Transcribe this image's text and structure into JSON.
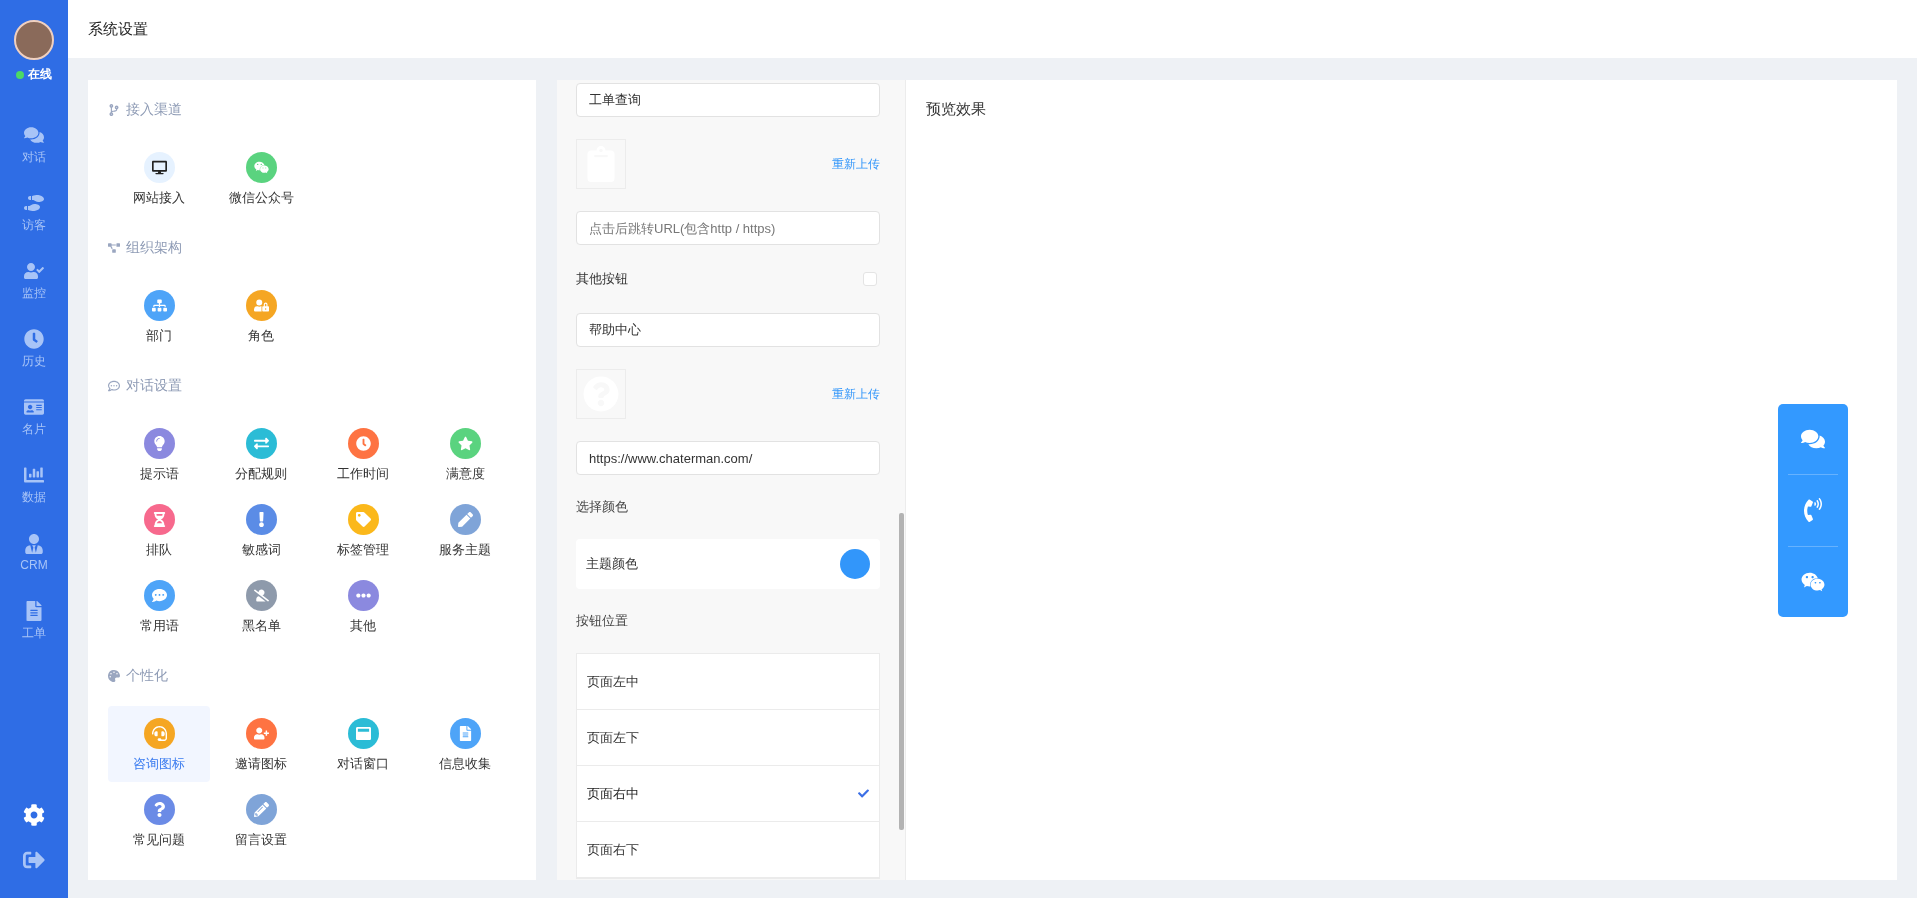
{
  "sidebar": {
    "status": "在线",
    "nav": [
      {
        "label": "对话"
      },
      {
        "label": "访客"
      },
      {
        "label": "监控"
      },
      {
        "label": "历史"
      },
      {
        "label": "名片"
      },
      {
        "label": "数据"
      },
      {
        "label": "CRM"
      },
      {
        "label": "工单"
      }
    ]
  },
  "header": {
    "title": "系统设置"
  },
  "settings_menu": {
    "sections": [
      {
        "title": "接入渠道",
        "items": [
          {
            "label": "网站接入",
            "selected": false
          },
          {
            "label": "微信公众号",
            "selected": false
          }
        ]
      },
      {
        "title": "组织架构",
        "items": [
          {
            "label": "部门",
            "selected": false
          },
          {
            "label": "角色",
            "selected": false
          }
        ]
      },
      {
        "title": "对话设置",
        "items": [
          {
            "label": "提示语",
            "selected": false
          },
          {
            "label": "分配规则",
            "selected": false
          },
          {
            "label": "工作时间",
            "selected": false
          },
          {
            "label": "满意度",
            "selected": false
          },
          {
            "label": "排队",
            "selected": false
          },
          {
            "label": "敏感词",
            "selected": false
          },
          {
            "label": "标签管理",
            "selected": false
          },
          {
            "label": "服务主题",
            "selected": false
          },
          {
            "label": "常用语",
            "selected": false
          },
          {
            "label": "黑名单",
            "selected": false
          },
          {
            "label": "其他",
            "selected": false
          }
        ]
      },
      {
        "title": "个性化",
        "items": [
          {
            "label": "咨询图标",
            "selected": true
          },
          {
            "label": "邀请图标",
            "selected": false
          },
          {
            "label": "对话窗口",
            "selected": false
          },
          {
            "label": "信息收集",
            "selected": false
          },
          {
            "label": "常见问题",
            "selected": false
          },
          {
            "label": "留言设置",
            "selected": false
          }
        ]
      }
    ]
  },
  "form": [
    {
      "kind": "input",
      "value": "工单查询"
    },
    {
      "kind": "upload",
      "link": "重新上传"
    },
    {
      "kind": "input",
      "placeholder": "点击后跳转URL(包含http / https)"
    },
    {
      "kind": "toggle",
      "label": "其他按钮",
      "checked": false
    },
    {
      "kind": "input",
      "value": "帮助中心"
    },
    {
      "kind": "upload",
      "link": "重新上传"
    },
    {
      "kind": "input",
      "value": "https://www.chaterman.com/"
    },
    {
      "kind": "heading",
      "label": "选择颜色"
    },
    {
      "kind": "color",
      "label": "主题颜色",
      "color": "#3296fa"
    },
    {
      "kind": "heading",
      "label": "按钮位置"
    },
    {
      "kind": "options",
      "options": [
        {
          "label": "页面左中",
          "selected": false
        },
        {
          "label": "页面左下",
          "selected": false
        },
        {
          "label": "页面右中",
          "selected": true
        },
        {
          "label": "页面右下",
          "selected": false
        }
      ]
    }
  ],
  "preview": {
    "title": "预览效果"
  }
}
